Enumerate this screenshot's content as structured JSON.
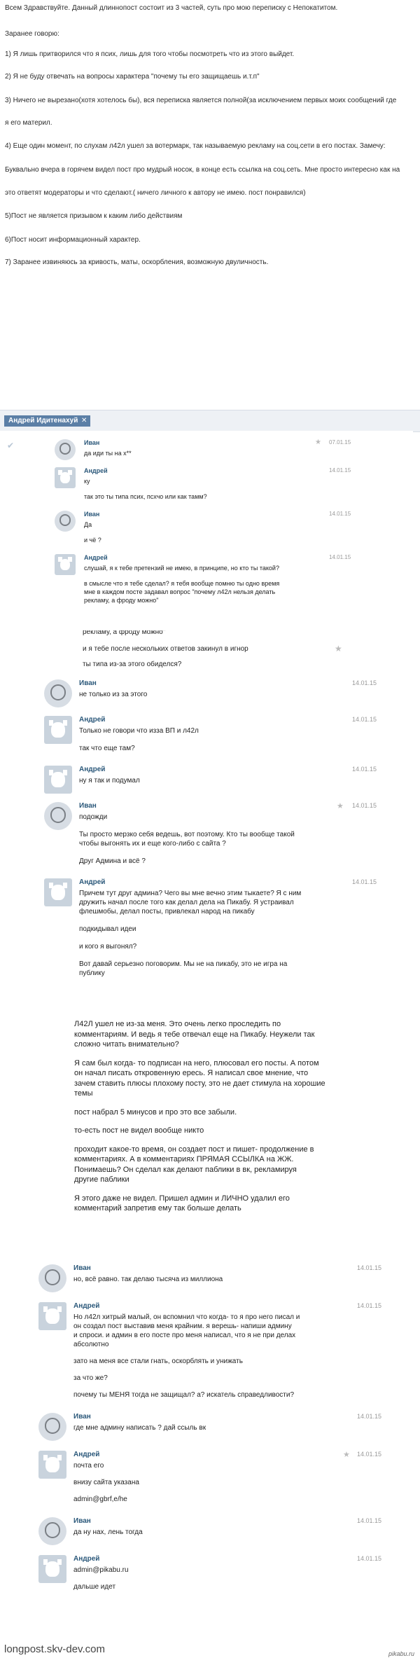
{
  "intro": [
    "Всем Здравствуйте. Данный длиннопост состоит из 3 частей, суть про мою переписку с Непокатитом.",
    "Заранее говорю:",
    "1) Я лишь притворился что я псих, лишь для того чтобы посмотреть что из этого выйдет.",
    "2) Я не буду отвечать на вопросы характера \"почему ты его защищаешь и.т.п\"",
    "3) Ничего не вырезано(хотя хотелось бы), вся переписка является полной(за исключением первых моих сообщений где",
    "я его материл.",
    "4) Еще один момент, по слухам л42л ушел за вотермарк, так называемую рекламу на соц.сети в его постах. Замечу:",
    "Буквально вчера в горячем видел пост про мудрый носок, в конце есть ссылка на соц.сеть. Мне просто интересно как на",
    "это ответят модераторы и что сделают.( ничего личного к автору не имею. пост понравился)",
    "5)Пост не является призывом к каким либо действиям",
    "6)Пост носит информационный характер.",
    "7) Заранее извиняюсь за кривость, маты, оскорбления, возможную двуличность."
  ],
  "tag": {
    "label": "Андрей Идитенахуй",
    "close": "✕"
  },
  "icons": {
    "star": "★",
    "check": "✔"
  },
  "frag1": [
    {
      "name": "Иван",
      "date": "07.01.15",
      "av": "ivan",
      "star": true,
      "check": true,
      "lines": [
        "да иди ты на х**"
      ]
    },
    {
      "name": "Андрей",
      "date": "14.01.15",
      "av": "dog",
      "lines": [
        "ку",
        "так это ты типа псих, псхчо или как тамм?"
      ]
    },
    {
      "name": "Иван",
      "date": "14.01.15",
      "av": "ivan",
      "lines": [
        "Да",
        "и чё ?"
      ]
    },
    {
      "name": "Андрей",
      "date": "14.01.15",
      "av": "dog",
      "lines": [
        "слушай, я к тебе претензий не имею, в принципе, но кто ты такой?",
        "в смысле что я тебе сделал? я тебя вообще помню ты одно время\nмне в каждом посте задавал вопрос \"почему л42л нельзя делать\nрекламу, а фроду можно\""
      ]
    }
  ],
  "frag2": {
    "cut": "рекламу, а фроду можно\"",
    "lines": [
      "и я тебе после нескольких ответов закинул в игнор",
      "ты типа из-за этого обиделся?"
    ],
    "messages": [
      {
        "name": "Иван",
        "date": "14.01.15",
        "av": "ivan",
        "lines": [
          "не только из за этого"
        ]
      },
      {
        "name": "Андрей",
        "date": "14.01.15",
        "av": "dog",
        "lines": [
          "Только не говори что изза ВП и л42л",
          "так что еще там?"
        ]
      },
      {
        "name": "Андрей",
        "date": "14.01.15",
        "av": "dog",
        "lines": [
          "ну я так и подумал"
        ]
      },
      {
        "name": "Иван",
        "date": "14.01.15",
        "av": "ivan",
        "star": true,
        "lines": [
          "подожди",
          "Ты просто мерзко себя ведешь, вот поэтому. Кто ты вообще такой\nчтобы выгонять их и еще кого-либо с сайта ?",
          "Друг Админа и всё ?"
        ]
      },
      {
        "name": "Андрей",
        "date": "14.01.15",
        "av": "dog",
        "lines": [
          "Причем тут друг админа? Чего вы мне вечно этим тыкаете? Я с ним\nдружить начал после того как делал дела на Пикабу. Я устраивал\nфлешмобы, делал посты, привлекал народ на пикабу",
          "подкидывал идеи",
          "и кого я выгонял?",
          "Вот давай серьезно поговорим. Мы не на пикабу, это не игра на\nпублику"
        ]
      }
    ]
  },
  "frag3": [
    "Л42Л ушел не из-за меня. Это очень легко проследить по\nкомментариям. И ведь я тебе отвечал еще на Пикабу. Неужели так\nсложно читать внимательно?",
    "Я сам был когда- то подписан на него, плюсовал его посты. А потом\nон начал писать откровенную ересь. Я написал свое мнение, что\nзачем ставить плюсы плохому посту, это не дает стимула на хорошие\nтемы",
    "пост набрал 5 минусов и про это все забыли.",
    "то-есть пост не видел вообще никто",
    "проходит какое-то время, он создает пост и пишет- продолжение в\nкомментариях. А в комментариях ПРЯМАЯ ССЫЛКА на ЖЖ.\nПонимаешь? Он сделал как делают паблики в вк, рекламируя\nдругие паблики",
    "Я этого даже не видел. Пришел админ и ЛИЧНО удалил его\nкомментарий запретив ему так больше делать"
  ],
  "frag4": [
    {
      "name": "Иван",
      "date": "14.01.15",
      "av": "ivan",
      "lines": [
        "но, всё равно. так делаю тысяча из миллиона"
      ]
    },
    {
      "name": "Андрей",
      "date": "14.01.15",
      "av": "dog",
      "lines": [
        "Но л42л хитрый малый, он вспомнил что когда- то я про него писал и\nон создал пост выставив меня крайним. я верешь- напиши админу\nи спроси. и админ в его посте про меня написал, что я не при делах\nабсолютно",
        "зато на меня все стали гнать, оскорблять и унижать",
        "за что же?",
        "почему ты МЕНЯ тогда не защищал? а? искатель справедливости?"
      ]
    },
    {
      "name": "Иван",
      "date": "14.01.15",
      "av": "ivan",
      "lines": [
        "где мне админу написать ? дай ссыль вк"
      ]
    },
    {
      "name": "Андрей",
      "date": "14.01.15",
      "av": "dog",
      "star": true,
      "lines": [
        "почта его",
        "внизу сайта указана",
        "admin@gbrf,e/he"
      ]
    },
    {
      "name": "Иван",
      "date": "14.01.15",
      "av": "ivan",
      "lines": [
        "да ну нах, лень тогда"
      ]
    },
    {
      "name": "Андрей",
      "date": "14.01.15",
      "av": "dog",
      "lines": [
        "admin@pikabu.ru",
        "дальше идет"
      ]
    }
  ],
  "footer": "longpost.skv-dev.com",
  "brand": "pikabu.ru"
}
